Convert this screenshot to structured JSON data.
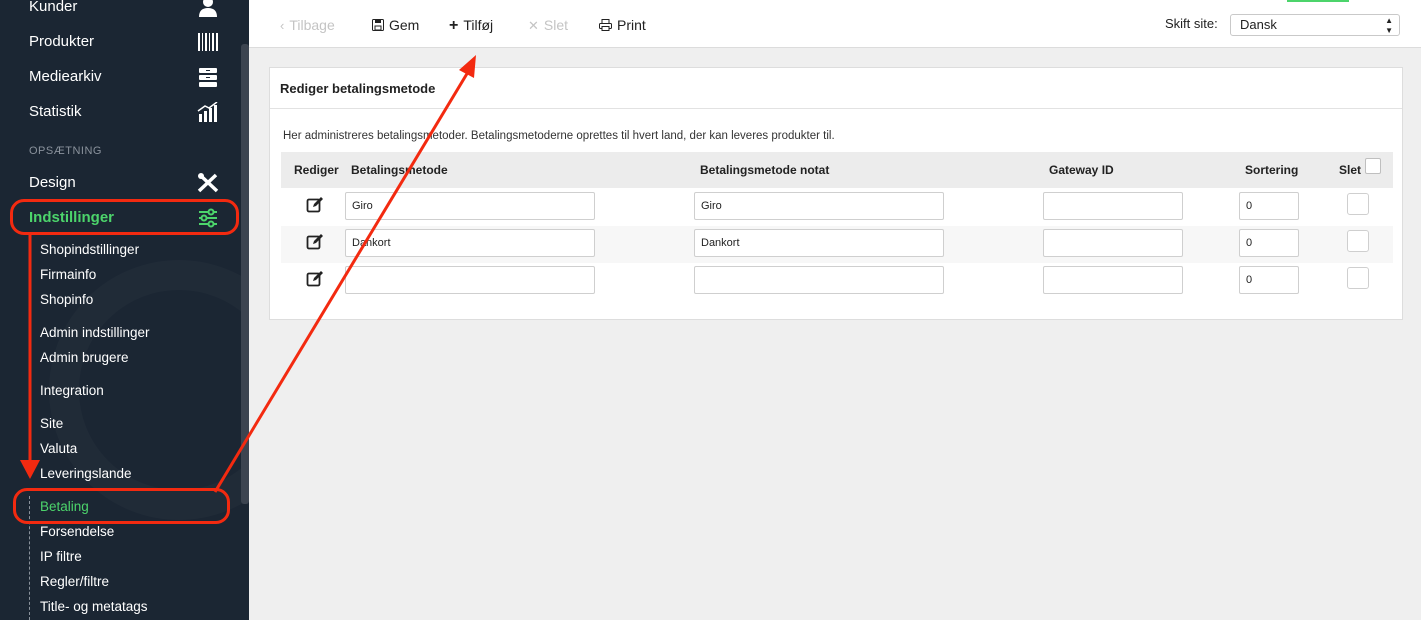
{
  "sidebar": {
    "main_items": [
      {
        "label": "Kunder",
        "icon": "customers-icon"
      },
      {
        "label": "Produkter",
        "icon": "barcode-icon"
      },
      {
        "label": "Mediearkiv",
        "icon": "media-archive-icon"
      },
      {
        "label": "Statistik",
        "icon": "statistics-icon"
      }
    ],
    "section_label": "OPSÆTNING",
    "design_label": "Design",
    "settings_label": "Indstillinger",
    "sub_items": [
      "Shopindstillinger",
      "Firmainfo",
      "Shopinfo",
      "Admin indstillinger",
      "Admin brugere",
      "Integration",
      "Site",
      "Valuta",
      "Leveringslande",
      "Betaling",
      "Forsendelse",
      "IP filtre",
      "Regler/filtre",
      "Title- og metatags"
    ],
    "active_sub": "Betaling"
  },
  "toolbar": {
    "back_label": "Tilbage",
    "save_label": "Gem",
    "add_label": "Tilføj",
    "delete_label": "Slet",
    "print_label": "Print",
    "site_label": "Skift site:",
    "site_value": "Dansk"
  },
  "panel": {
    "title": "Rediger betalingsmetode",
    "description": "Her administreres betalingsmetoder. Betalingsmetoderne oprettes til hvert land, der kan leveres produkter til.",
    "columns": [
      "Rediger",
      "Betalingsmetode",
      "Betalingsmetode notat",
      "Gateway ID",
      "Sortering",
      "Slet"
    ],
    "rows": [
      {
        "method": "Giro",
        "note": "Giro",
        "gateway": "",
        "sort": "0"
      },
      {
        "method": "Dankort",
        "note": "Dankort",
        "gateway": "",
        "sort": "0"
      },
      {
        "method": "",
        "note": "",
        "gateway": "",
        "sort": "0"
      }
    ]
  },
  "colors": {
    "sidebar_bg": "#1b2633",
    "accent_green": "#4cd46b",
    "annotation_red": "#f32a10"
  }
}
